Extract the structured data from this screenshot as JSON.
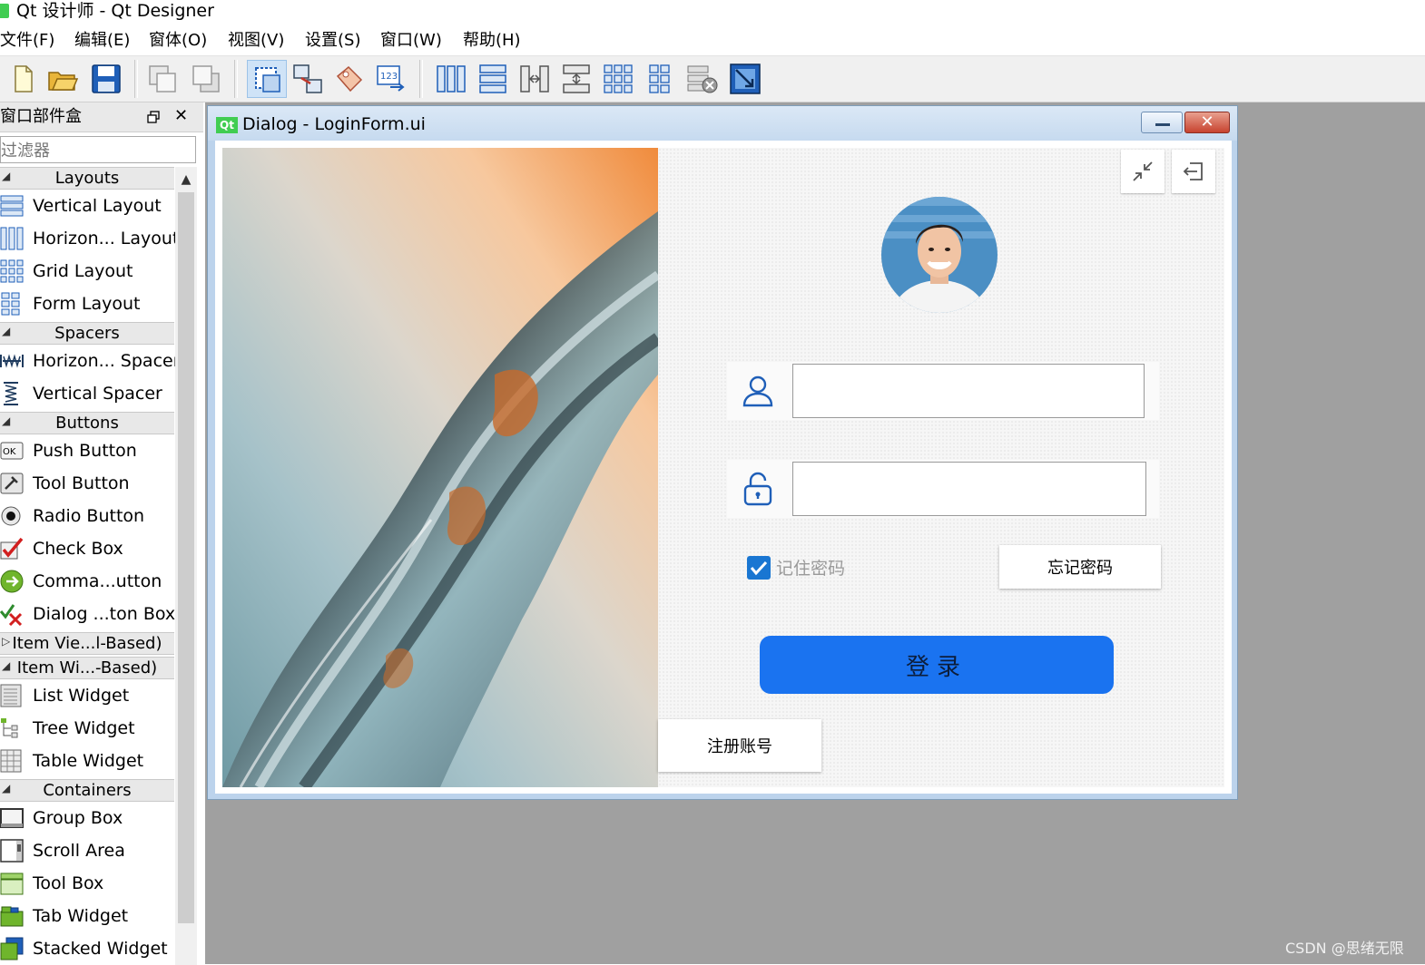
{
  "window": {
    "title": "Qt 设计师 - Qt Designer"
  },
  "menu": {
    "items": [
      "文件(F)",
      "编辑(E)",
      "窗体(O)",
      "视图(V)",
      "设置(S)",
      "窗口(W)",
      "帮助(H)"
    ]
  },
  "toolbar": {
    "icons": [
      "new-file-icon",
      "open-folder-icon",
      "save-icon",
      "send-back-icon",
      "bring-front-icon",
      "edit-widgets-icon",
      "edit-signals-icon",
      "edit-buddies-icon",
      "edit-tab-order-icon",
      "layout-horizontal-icon",
      "layout-vertical-icon",
      "layout-horizontal-splitter-icon",
      "layout-vertical-splitter-icon",
      "layout-grid-icon",
      "layout-form-icon",
      "break-layout-icon",
      "adjust-size-icon"
    ],
    "active": "edit-widgets-icon"
  },
  "widget_box": {
    "title": "窗口部件盒",
    "filter_placeholder": "过滤器",
    "categories": {
      "layouts": "Layouts",
      "spacers": "Spacers",
      "buttons": "Buttons",
      "item_views": "Item Vie...l-Based)",
      "item_widgets": "Item Wi...-Based)",
      "containers": "Containers"
    },
    "items": {
      "vertical_layout": "Vertical Layout",
      "horizontal_layout": "Horizon... Layout",
      "grid_layout": "Grid Layout",
      "form_layout": "Form Layout",
      "horizontal_spacer": "Horizon... Spacer",
      "vertical_spacer": "Vertical Spacer",
      "push_button": "Push Button",
      "tool_button": "Tool Button",
      "radio_button": "Radio Button",
      "check_box": "Check Box",
      "command_link": "Comma...utton",
      "dialog_button_box": "Dialog ...ton Box",
      "list_widget": "List Widget",
      "tree_widget": "Tree Widget",
      "table_widget": "Table Widget",
      "group_box": "Group Box",
      "scroll_area": "Scroll Area",
      "tool_box": "Tool Box",
      "tab_widget": "Tab Widget",
      "stacked_widget": "Stacked Widget"
    },
    "ok_icon_text": "OK"
  },
  "dialog": {
    "qt_badge": "Qt",
    "title": "Dialog - LoginForm.ui",
    "close_glyph": "✕",
    "form": {
      "username_value": "",
      "password_value": "",
      "remember_label": "记住密码",
      "remember_checked": true,
      "forgot_label": "忘记密码",
      "login_label": "登录",
      "register_label": "注册账号"
    }
  },
  "watermark": "CSDN @思绪无限",
  "colors": {
    "accent": "#1a73f0",
    "qt_green": "#41cd52",
    "checkbox": "#1976d2",
    "mdi_background": "#a0a0a0"
  }
}
